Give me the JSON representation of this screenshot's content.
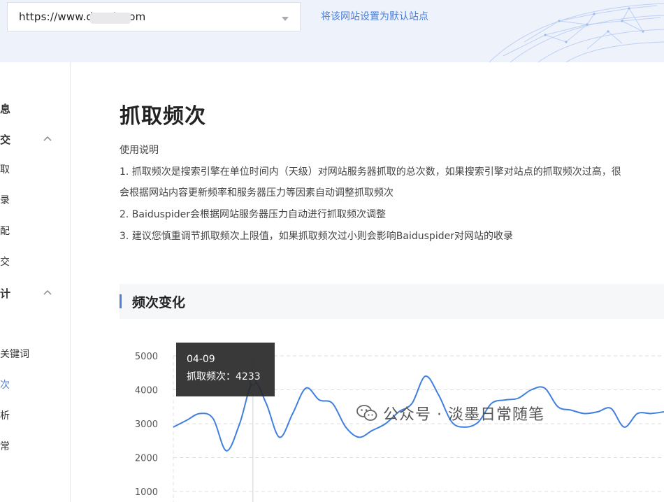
{
  "header": {
    "url_value": "https://www.dro      ck.com",
    "default_site_link": "将该网站设置为默认站点"
  },
  "sidebar": {
    "items": [
      {
        "label": "息"
      },
      {
        "label": "交"
      },
      {
        "label": "取"
      },
      {
        "label": "录"
      },
      {
        "label": "配"
      },
      {
        "label": "交"
      },
      {
        "label": "计"
      },
      {
        "label": "关键词"
      },
      {
        "label": "次"
      },
      {
        "label": "析"
      },
      {
        "label": "常"
      }
    ]
  },
  "main": {
    "title": "抓取频次",
    "usage_heading": "使用说明",
    "usage_lines": [
      "1. 抓取频次是搜索引擎在单位时间内（天级）对网站服务器抓取的总次数，如果搜索引擎对站点的抓取频次过高，很",
      "会根据网站内容更新频率和服务器压力等因素自动调整抓取频次",
      "2. Baiduspider会根据网站服务器压力自动进行抓取频次调整",
      "3. 建议您慎重调节抓取频次上限值，如果抓取频次过小则会影响Baiduspider对网站的收录"
    ],
    "section_title": "频次变化"
  },
  "tooltip": {
    "date": "04-09",
    "label_value": "抓取频次：4233"
  },
  "watermark": {
    "text": "公众号 · 淡墨日常随笔"
  },
  "colors": {
    "accent": "#4d7ed8",
    "line": "#3f7fde"
  },
  "chart_data": {
    "type": "line",
    "ylim": [
      1000,
      5000
    ],
    "y_ticks": [
      "5000",
      "4000",
      "3000",
      "2000",
      "1000"
    ],
    "grid": true,
    "highlight": {
      "x": "04-09",
      "y": 4233
    },
    "series": [
      {
        "values": [
          2900,
          3100,
          3300,
          3150,
          2200,
          3000,
          4233,
          3600,
          2600,
          3300,
          4050,
          3700,
          3600,
          2900,
          2600,
          2800,
          3000,
          3350,
          3600,
          4400,
          3850,
          3050,
          2900,
          3050,
          3600,
          3700,
          3750,
          4000,
          4050,
          3500,
          3400,
          3300,
          3350,
          3450,
          2900,
          3300,
          3300,
          3350
        ]
      }
    ]
  }
}
